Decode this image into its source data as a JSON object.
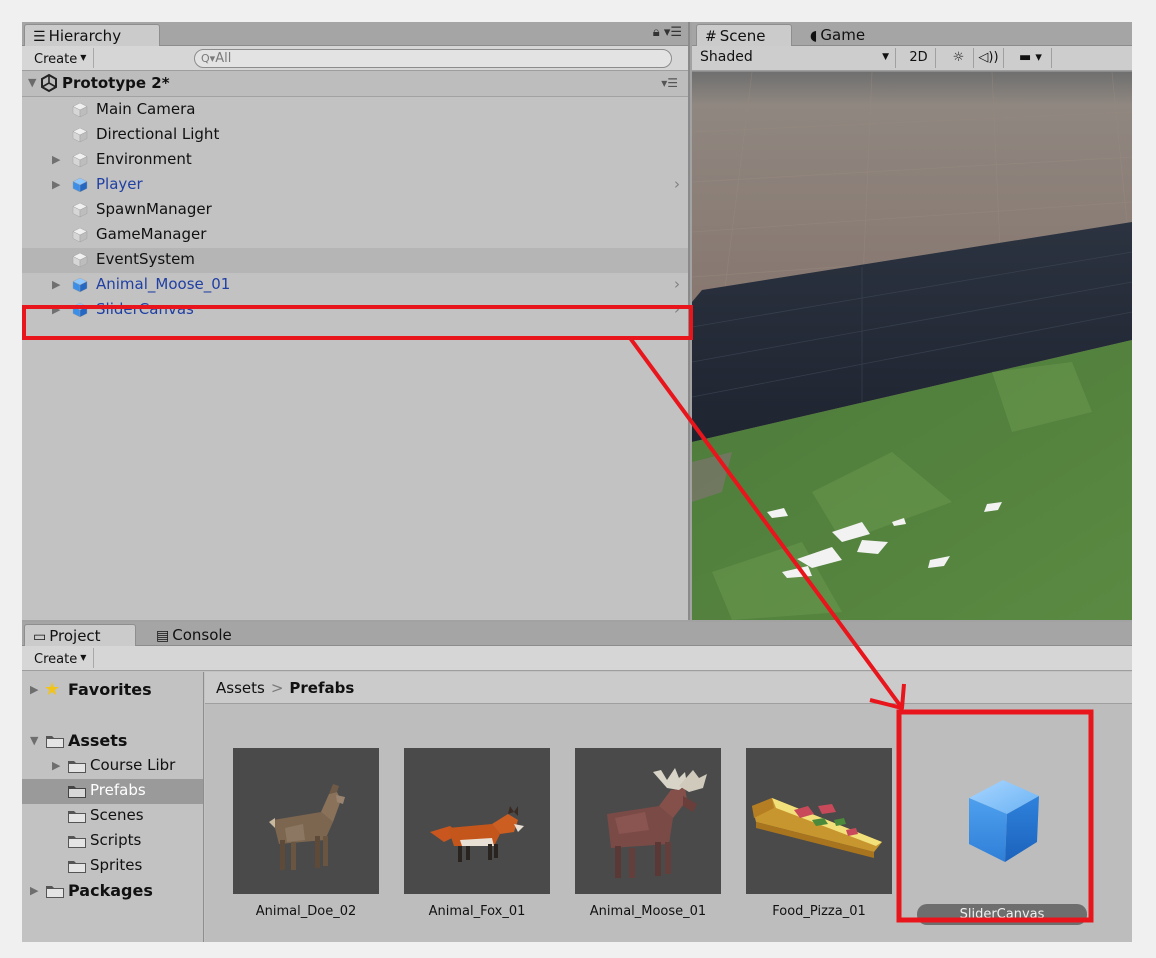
{
  "hierarchy": {
    "tab_label": "Hierarchy",
    "create_label": "Create",
    "search_placeholder": "All",
    "scene_name": "Prototype 2*",
    "items": [
      {
        "label": "Main Camera",
        "type": "object"
      },
      {
        "label": "Directional Light",
        "type": "object"
      },
      {
        "label": "Environment",
        "type": "object"
      },
      {
        "label": "Player",
        "type": "prefab"
      },
      {
        "label": "SpawnManager",
        "type": "object"
      },
      {
        "label": "GameManager",
        "type": "object"
      },
      {
        "label": "EventSystem",
        "type": "object"
      },
      {
        "label": "Animal_Moose_01",
        "type": "prefab"
      },
      {
        "label": "SliderCanvas",
        "type": "prefab"
      }
    ]
  },
  "scene": {
    "tab_scene": "Scene",
    "tab_game": "Game",
    "shading_mode": "Shaded",
    "btn_2d": "2D"
  },
  "project": {
    "tab_project": "Project",
    "tab_console": "Console",
    "create_label": "Create",
    "tree": {
      "favorites": "Favorites",
      "assets": "Assets",
      "course_library": "Course Libr",
      "prefabs": "Prefabs",
      "scenes": "Scenes",
      "scripts": "Scripts",
      "sprites": "Sprites",
      "packages": "Packages"
    },
    "breadcrumb_root": "Assets",
    "breadcrumb_current": "Prefabs",
    "assets": [
      {
        "name": "Animal_Doe_02",
        "icon": "doe-thumbnail"
      },
      {
        "name": "Animal_Fox_01",
        "icon": "fox-thumbnail"
      },
      {
        "name": "Animal_Moose_01",
        "icon": "moose-thumbnail"
      },
      {
        "name": "Food_Pizza_01",
        "icon": "pizza-thumbnail"
      },
      {
        "name": "SliderCanvas",
        "icon": "prefab-cube-icon"
      }
    ]
  },
  "colors": {
    "annotation_red": "#e8161c",
    "prefab_blue": "#1f3fa3",
    "cube_blue": "#3c8fe8"
  }
}
